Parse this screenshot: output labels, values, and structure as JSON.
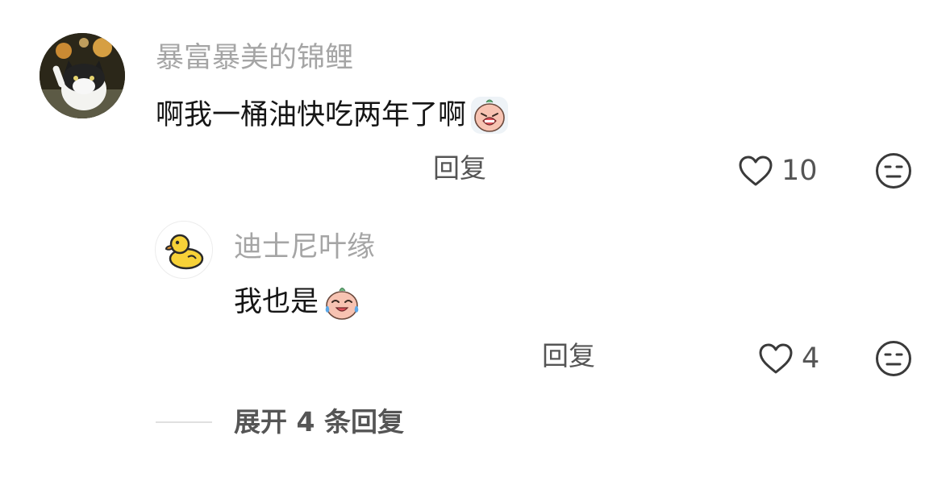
{
  "comment": {
    "username": "暴富暴美的锦鲤",
    "text": "啊我一桶油快吃两年了啊",
    "emoji": "crying-face-emoji",
    "reply_label": "回复",
    "like_count": "10"
  },
  "reply": {
    "username": "迪士尼叶缘",
    "text": "我也是",
    "emoji": "tears-of-joy-emoji",
    "reply_label": "回复",
    "like_count": "4"
  },
  "expand_label": "展开 4 条回复",
  "colors": {
    "username": "#a5a5a5",
    "text": "#161616",
    "action": "#555555",
    "divider": "#e0e0e0"
  }
}
